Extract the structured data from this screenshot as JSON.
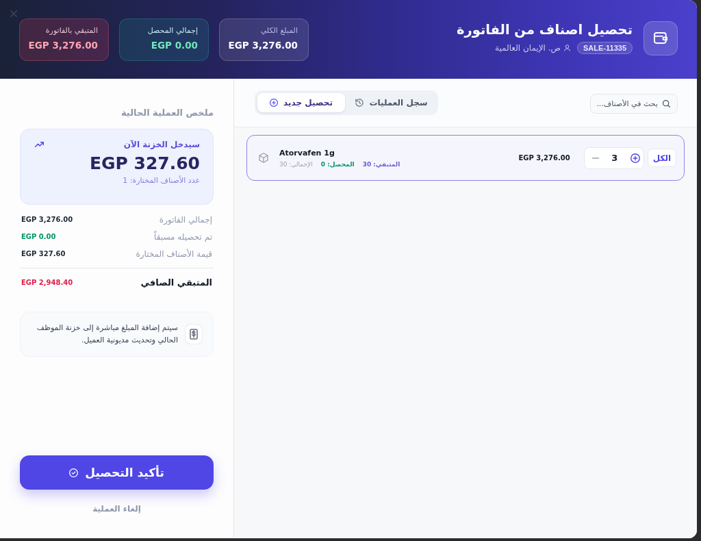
{
  "header": {
    "title": "تحصيل اصناف من الفاتورة",
    "invoice_badge": "SALE-11335",
    "customer": "ص. الإيمان العالمية",
    "stats": [
      {
        "kind": "total",
        "label": "المبلغ الكلي",
        "value": "EGP 3,276.00"
      },
      {
        "kind": "collected",
        "label": "إجمالي المحصل",
        "value": "EGP 0.00"
      },
      {
        "kind": "remaining",
        "label": "المتبقي بالفاتورة",
        "value": "EGP 3,276.00"
      }
    ]
  },
  "main": {
    "search": {
      "placeholder": "بحث في الأصناف..."
    },
    "tabs": [
      {
        "kind": "history",
        "label": "سجل العمليات",
        "selected": false
      },
      {
        "kind": "new",
        "label": "تحصيل جديد",
        "selected": true
      }
    ],
    "items": [
      {
        "name": "Atorvafen 1g",
        "counts": [
          {
            "kind": "remaining",
            "text": "المتبقي: 30"
          },
          {
            "kind": "collected",
            "text": "المحصل: 0"
          },
          {
            "kind": "total",
            "text": "الإجمالي: 30"
          }
        ],
        "price": "EGP 3,276.00",
        "quantity": "3",
        "all_button": "الكل",
        "selected": true
      }
    ]
  },
  "summary": {
    "heading": "ملخص العملية الحالية",
    "highlight": {
      "label": "سيدخل الخزنة الآن",
      "amount": "EGP 327.60",
      "count": "عدد الأصناف المختارة: 1"
    },
    "rows": [
      {
        "kind": "plain",
        "label": "إجمالي الفاتورة",
        "value": "EGP 3,276.00"
      },
      {
        "kind": "positive",
        "label": "تم تحصيله مسبقاً",
        "value": "EGP 0.00"
      },
      {
        "kind": "plain",
        "label": "قيمة الأصناف المختارة",
        "value": "EGP 327.60"
      },
      {
        "kind": "net",
        "label": "المتبقي الصافي",
        "value": "EGP 2,948.40"
      }
    ],
    "note": "سيتم إضافة المبلغ مباشرة إلى خزنة الموظف الحالي وتحديث مديونية العميل.",
    "confirm_button": "تأكيد التحصيل",
    "cancel_link": "إلغاء العملية"
  }
}
